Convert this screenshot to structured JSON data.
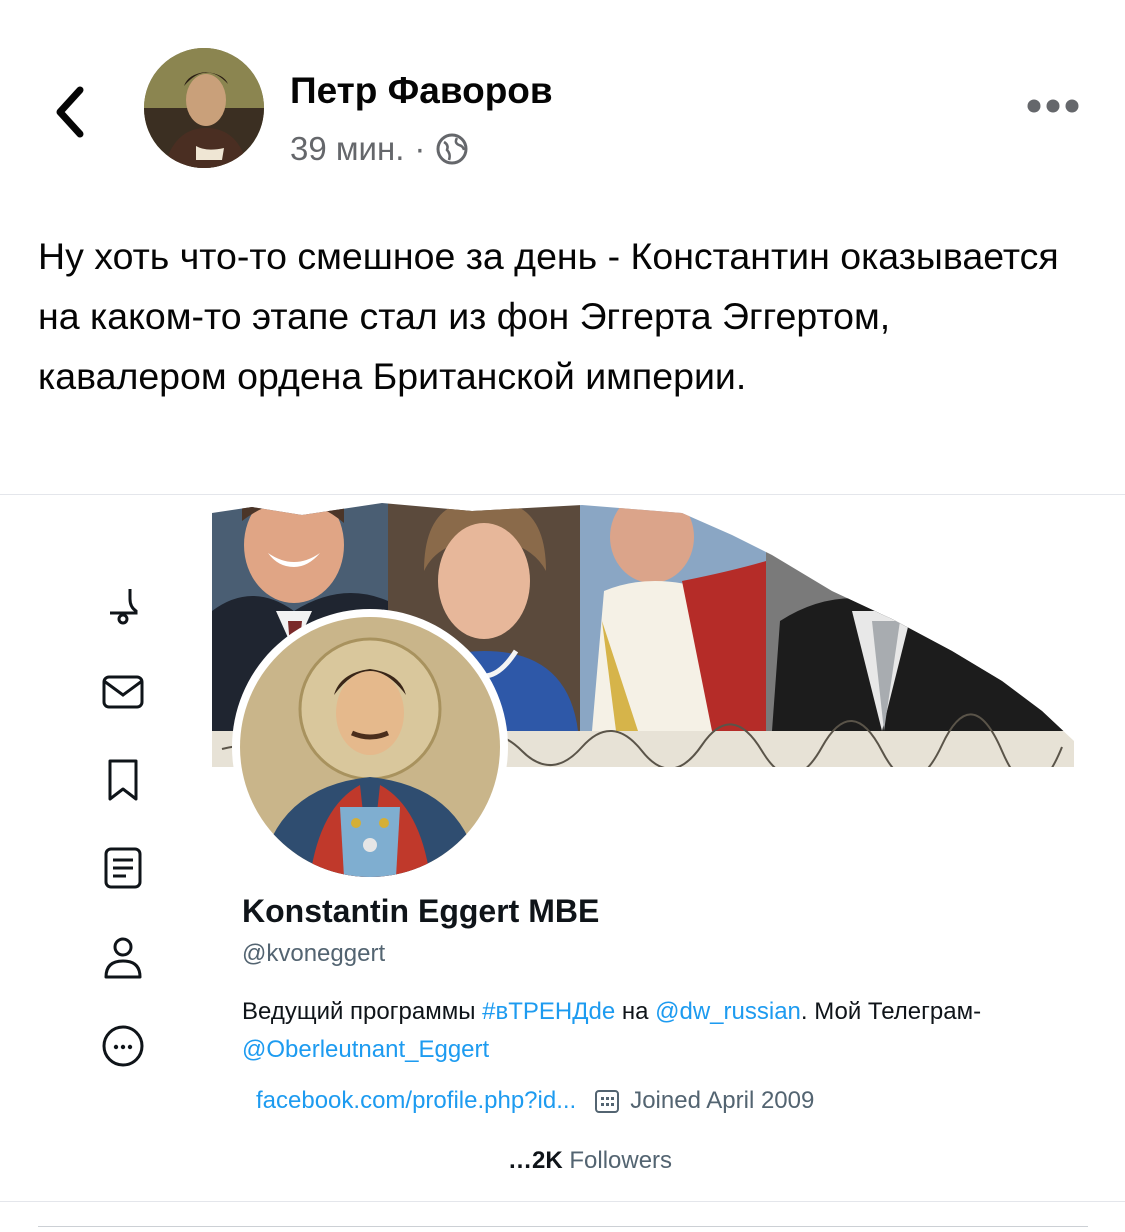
{
  "header": {
    "back_icon": "chevron-left-icon",
    "author_name": "Петр Фаворов",
    "timestamp": "39 мин.",
    "separator": "·",
    "privacy_icon": "globe-icon",
    "more_icon": "more-horizontal-icon"
  },
  "post": {
    "text": "Ну хоть что-то смешное за день - Константин оказывается на каком-то этапе  стал из фон Эггерта Эггертом, кавалером ордена Британской империи."
  },
  "twitter_profile": {
    "sidebar_icons": [
      "notifications-icon",
      "messages-icon",
      "bookmarks-icon",
      "lists-icon",
      "profile-icon",
      "more-icon"
    ],
    "name": "Konstantin Eggert MBE",
    "handle": "@kvoneggert",
    "bio_text_1": "Ведущий программы ",
    "bio_hashtag": "#вТРЕНДde",
    "bio_text_2": " на ",
    "bio_mention_1": "@dw_russian",
    "bio_text_3": ". Мой Телеграм-",
    "bio_mention_2": "@Oberleutnant_Eggert",
    "website": "facebook.com/profile.php?id...",
    "joined": "Joined April 2009",
    "followers_count": "…2K",
    "followers_label": "Followers"
  }
}
